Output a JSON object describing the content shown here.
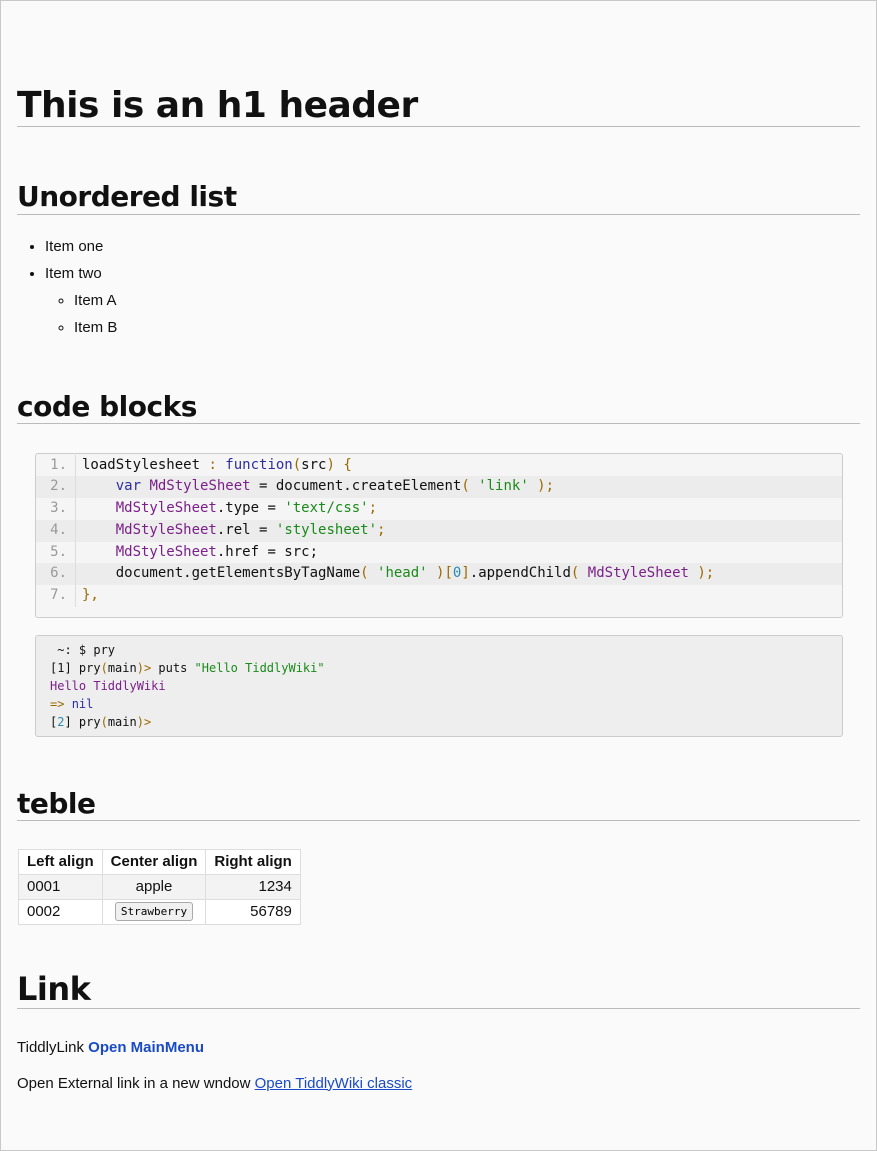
{
  "h1": "This is an h1 header",
  "list": {
    "heading": "Unordered list",
    "items": [
      "Item one",
      "Item two"
    ],
    "sub_items": [
      "Item A",
      "Item B"
    ]
  },
  "code": {
    "heading": "code blocks",
    "lines": [
      [
        [
          "loadStylesheet ",
          "t"
        ],
        [
          ": ",
          "p"
        ],
        [
          "function",
          "k"
        ],
        [
          "(",
          "p"
        ],
        [
          "src",
          "t"
        ],
        [
          ") {",
          "p"
        ]
      ],
      [
        [
          "    ",
          "t"
        ],
        [
          "var ",
          "k"
        ],
        [
          "MdStyleSheet",
          "v"
        ],
        [
          " = document.createElement",
          "t"
        ],
        [
          "( ",
          "p"
        ],
        [
          "'link'",
          "s"
        ],
        [
          " );",
          "p"
        ]
      ],
      [
        [
          "    ",
          "t"
        ],
        [
          "MdStyleSheet",
          "v"
        ],
        [
          ".type = ",
          "t"
        ],
        [
          "'text/css'",
          "s"
        ],
        [
          ";",
          "p"
        ]
      ],
      [
        [
          "    ",
          "t"
        ],
        [
          "MdStyleSheet",
          "v"
        ],
        [
          ".rel = ",
          "t"
        ],
        [
          "'stylesheet'",
          "s"
        ],
        [
          ";",
          "p"
        ]
      ],
      [
        [
          "    ",
          "t"
        ],
        [
          "MdStyleSheet",
          "v"
        ],
        [
          ".href = src;",
          "t"
        ]
      ],
      [
        [
          "    document.getElementsByTagName",
          "t"
        ],
        [
          "( ",
          "p"
        ],
        [
          "'head'",
          "s"
        ],
        [
          " )[",
          "p"
        ],
        [
          "0",
          "n"
        ],
        [
          "]",
          "p"
        ],
        [
          ".appendChild",
          "t"
        ],
        [
          "( ",
          "p"
        ],
        [
          "MdStyleSheet",
          "v"
        ],
        [
          " );",
          "p"
        ]
      ],
      [
        [
          "},",
          "p"
        ]
      ]
    ],
    "terminal": [
      [
        [
          " ~: $ pry",
          "t"
        ]
      ],
      [
        [
          "[1] ",
          "t"
        ],
        [
          "pry",
          "t"
        ],
        [
          "(",
          "p"
        ],
        [
          "main",
          "t"
        ],
        [
          ")>",
          "p"
        ],
        [
          " puts ",
          "t"
        ],
        [
          "\"Hello TiddlyWiki\"",
          "s"
        ]
      ],
      [
        [
          "Hello TiddlyWiki",
          "v"
        ]
      ],
      [
        [
          "=> ",
          "p"
        ],
        [
          "nil",
          "k"
        ]
      ],
      [
        [
          "[",
          "t"
        ],
        [
          "2",
          "n"
        ],
        [
          "] pry",
          "t"
        ],
        [
          "(",
          "p"
        ],
        [
          "main",
          "t"
        ],
        [
          ")>",
          "p"
        ]
      ]
    ]
  },
  "table": {
    "heading": "teble",
    "headers": [
      "Left align",
      "Center align",
      "Right align"
    ],
    "rows": [
      [
        "0001",
        "apple",
        "1234"
      ],
      [
        "0002",
        "Strawberry",
        "56789"
      ]
    ]
  },
  "link": {
    "heading": "Link",
    "line1_text": "TiddlyLink",
    "line1_link": "Open MainMenu",
    "line2_text": "Open External link in a new wndow",
    "line2_link": "Open TiddlyWiki classic"
  }
}
